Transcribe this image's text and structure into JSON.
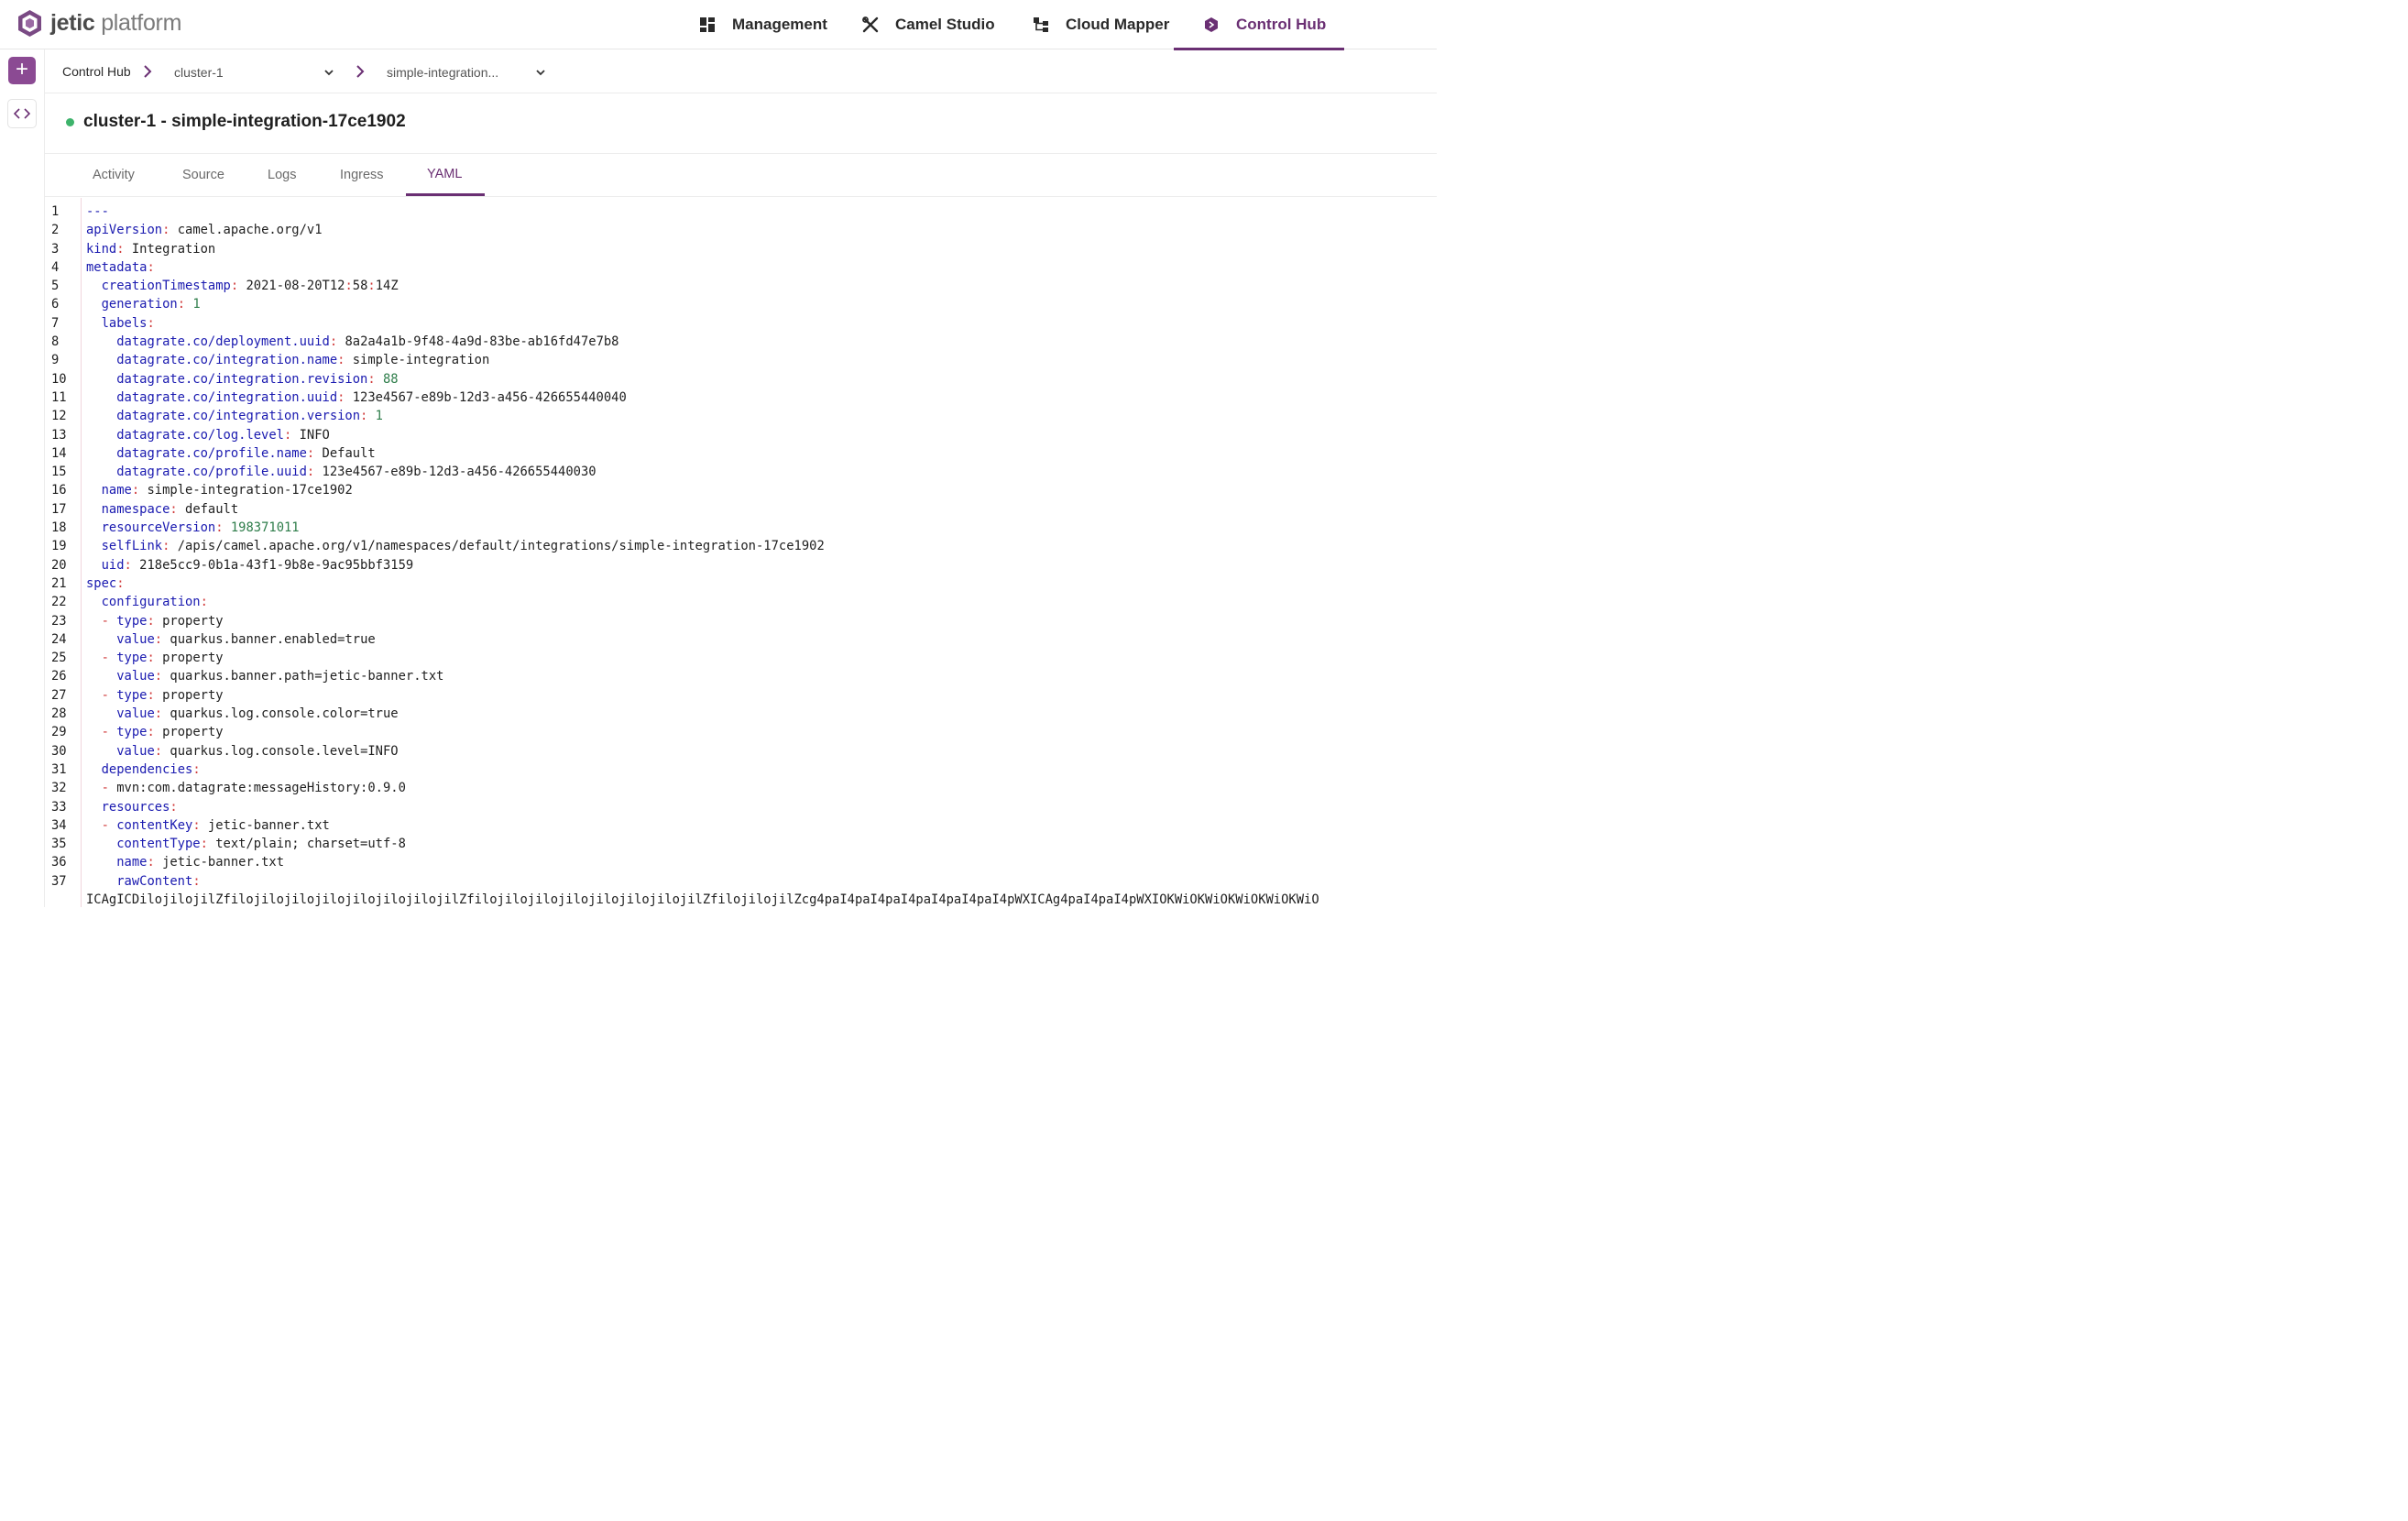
{
  "brand": {
    "name_bold": "jetic",
    "name_light": "platform"
  },
  "nav": {
    "items": [
      {
        "label": "Management",
        "icon": "grid-icon",
        "active": false
      },
      {
        "label": "Camel Studio",
        "icon": "tools-icon",
        "active": false
      },
      {
        "label": "Cloud Mapper",
        "icon": "hierarchy-icon",
        "active": false
      },
      {
        "label": "Control Hub",
        "icon": "hexagon-icon",
        "active": true
      }
    ],
    "accent_color": "#6a2f73"
  },
  "rail": {
    "add_label": "+",
    "code_label": "<>"
  },
  "breadcrumb": {
    "root": "Control Hub",
    "cluster": "cluster-1",
    "integration": "simple-integration..."
  },
  "header": {
    "title": "cluster-1 - simple-integration-17ce1902",
    "status_color": "#3db36b"
  },
  "tabs": [
    {
      "label": "Activity",
      "active": false
    },
    {
      "label": "Source",
      "active": false
    },
    {
      "label": "Logs",
      "active": false
    },
    {
      "label": "Ingress",
      "active": false
    },
    {
      "label": "YAML",
      "active": true
    }
  ],
  "editor": {
    "lines": [
      {
        "n": "1",
        "indent": "",
        "dash": "",
        "key": "",
        "sep": "",
        "val": "",
        "vtype": "",
        "raw": "---"
      },
      {
        "n": "2",
        "indent": "",
        "dash": "",
        "key": "apiVersion",
        "sep": ": ",
        "val": "camel.apache.org/v1",
        "vtype": "s"
      },
      {
        "n": "3",
        "indent": "",
        "dash": "",
        "key": "kind",
        "sep": ": ",
        "val": "Integration",
        "vtype": "s"
      },
      {
        "n": "4",
        "indent": "",
        "dash": "",
        "key": "metadata",
        "sep": ":",
        "val": "",
        "vtype": ""
      },
      {
        "n": "5",
        "indent": "  ",
        "dash": "",
        "key": "creationTimestamp",
        "sep": ": ",
        "val": "2021-08-20T12:58:14Z",
        "vtype": "ts"
      },
      {
        "n": "6",
        "indent": "  ",
        "dash": "",
        "key": "generation",
        "sep": ": ",
        "val": "1",
        "vtype": "n"
      },
      {
        "n": "7",
        "indent": "  ",
        "dash": "",
        "key": "labels",
        "sep": ":",
        "val": "",
        "vtype": ""
      },
      {
        "n": "8",
        "indent": "    ",
        "dash": "",
        "key": "datagrate.co/deployment.uuid",
        "sep": ": ",
        "val": "8a2a4a1b-9f48-4a9d-83be-ab16fd47e7b8",
        "vtype": "s"
      },
      {
        "n": "9",
        "indent": "    ",
        "dash": "",
        "key": "datagrate.co/integration.name",
        "sep": ": ",
        "val": "simple-integration",
        "vtype": "s"
      },
      {
        "n": "10",
        "indent": "    ",
        "dash": "",
        "key": "datagrate.co/integration.revision",
        "sep": ": ",
        "val": "88",
        "vtype": "n"
      },
      {
        "n": "11",
        "indent": "    ",
        "dash": "",
        "key": "datagrate.co/integration.uuid",
        "sep": ": ",
        "val": "123e4567-e89b-12d3-a456-426655440040",
        "vtype": "s"
      },
      {
        "n": "12",
        "indent": "    ",
        "dash": "",
        "key": "datagrate.co/integration.version",
        "sep": ": ",
        "val": "1",
        "vtype": "n"
      },
      {
        "n": "13",
        "indent": "    ",
        "dash": "",
        "key": "datagrate.co/log.level",
        "sep": ": ",
        "val": "INFO",
        "vtype": "s"
      },
      {
        "n": "14",
        "indent": "    ",
        "dash": "",
        "key": "datagrate.co/profile.name",
        "sep": ": ",
        "val": "Default",
        "vtype": "s"
      },
      {
        "n": "15",
        "indent": "    ",
        "dash": "",
        "key": "datagrate.co/profile.uuid",
        "sep": ": ",
        "val": "123e4567-e89b-12d3-a456-426655440030",
        "vtype": "s"
      },
      {
        "n": "16",
        "indent": "  ",
        "dash": "",
        "key": "name",
        "sep": ": ",
        "val": "simple-integration-17ce1902",
        "vtype": "s"
      },
      {
        "n": "17",
        "indent": "  ",
        "dash": "",
        "key": "namespace",
        "sep": ": ",
        "val": "default",
        "vtype": "s"
      },
      {
        "n": "18",
        "indent": "  ",
        "dash": "",
        "key": "resourceVersion",
        "sep": ": ",
        "val": "198371011",
        "vtype": "n"
      },
      {
        "n": "19",
        "indent": "  ",
        "dash": "",
        "key": "selfLink",
        "sep": ": ",
        "val": "/apis/camel.apache.org/v1/namespaces/default/integrations/simple-integration-17ce1902",
        "vtype": "s"
      },
      {
        "n": "20",
        "indent": "  ",
        "dash": "",
        "key": "uid",
        "sep": ": ",
        "val": "218e5cc9-0b1a-43f1-9b8e-9ac95bbf3159",
        "vtype": "s"
      },
      {
        "n": "21",
        "indent": "",
        "dash": "",
        "key": "spec",
        "sep": ":",
        "val": "",
        "vtype": ""
      },
      {
        "n": "22",
        "indent": "  ",
        "dash": "",
        "key": "configuration",
        "sep": ":",
        "val": "",
        "vtype": ""
      },
      {
        "n": "23",
        "indent": "  ",
        "dash": "- ",
        "key": "type",
        "sep": ": ",
        "val": "property",
        "vtype": "s"
      },
      {
        "n": "24",
        "indent": "    ",
        "dash": "",
        "key": "value",
        "sep": ": ",
        "val": "quarkus.banner.enabled=true",
        "vtype": "s"
      },
      {
        "n": "25",
        "indent": "  ",
        "dash": "- ",
        "key": "type",
        "sep": ": ",
        "val": "property",
        "vtype": "s"
      },
      {
        "n": "26",
        "indent": "    ",
        "dash": "",
        "key": "value",
        "sep": ": ",
        "val": "quarkus.banner.path=jetic-banner.txt",
        "vtype": "s"
      },
      {
        "n": "27",
        "indent": "  ",
        "dash": "- ",
        "key": "type",
        "sep": ": ",
        "val": "property",
        "vtype": "s"
      },
      {
        "n": "28",
        "indent": "    ",
        "dash": "",
        "key": "value",
        "sep": ": ",
        "val": "quarkus.log.console.color=true",
        "vtype": "s"
      },
      {
        "n": "29",
        "indent": "  ",
        "dash": "- ",
        "key": "type",
        "sep": ": ",
        "val": "property",
        "vtype": "s"
      },
      {
        "n": "30",
        "indent": "    ",
        "dash": "",
        "key": "value",
        "sep": ": ",
        "val": "quarkus.log.console.level=INFO",
        "vtype": "s"
      },
      {
        "n": "31",
        "indent": "  ",
        "dash": "",
        "key": "dependencies",
        "sep": ":",
        "val": "",
        "vtype": ""
      },
      {
        "n": "32",
        "indent": "  ",
        "dash": "- ",
        "key": "",
        "sep": "",
        "val": "mvn:com.datagrate:messageHistory:0.9.0",
        "vtype": "s"
      },
      {
        "n": "33",
        "indent": "  ",
        "dash": "",
        "key": "resources",
        "sep": ":",
        "val": "",
        "vtype": ""
      },
      {
        "n": "34",
        "indent": "  ",
        "dash": "- ",
        "key": "contentKey",
        "sep": ": ",
        "val": "jetic-banner.txt",
        "vtype": "s"
      },
      {
        "n": "35",
        "indent": "    ",
        "dash": "",
        "key": "contentType",
        "sep": ": ",
        "val": "text/plain; charset=utf-8",
        "vtype": "s"
      },
      {
        "n": "36",
        "indent": "    ",
        "dash": "",
        "key": "name",
        "sep": ": ",
        "val": "jetic-banner.txt",
        "vtype": "s"
      },
      {
        "n": "37",
        "indent": "    ",
        "dash": "",
        "key": "rawContent",
        "sep": ":",
        "val": "",
        "vtype": ""
      }
    ],
    "overflow_line": "ICAgICDilojilojilZfilojilojilojilojilojilojilojilZfilojilojilojilojilojilojilojilZfilojilojilZcg4paI4paI4paI4paI4paI4paI4pWXICAg4paI4paI4pWXIOKWiOKWiOKWiOKWiOKWiO"
  }
}
